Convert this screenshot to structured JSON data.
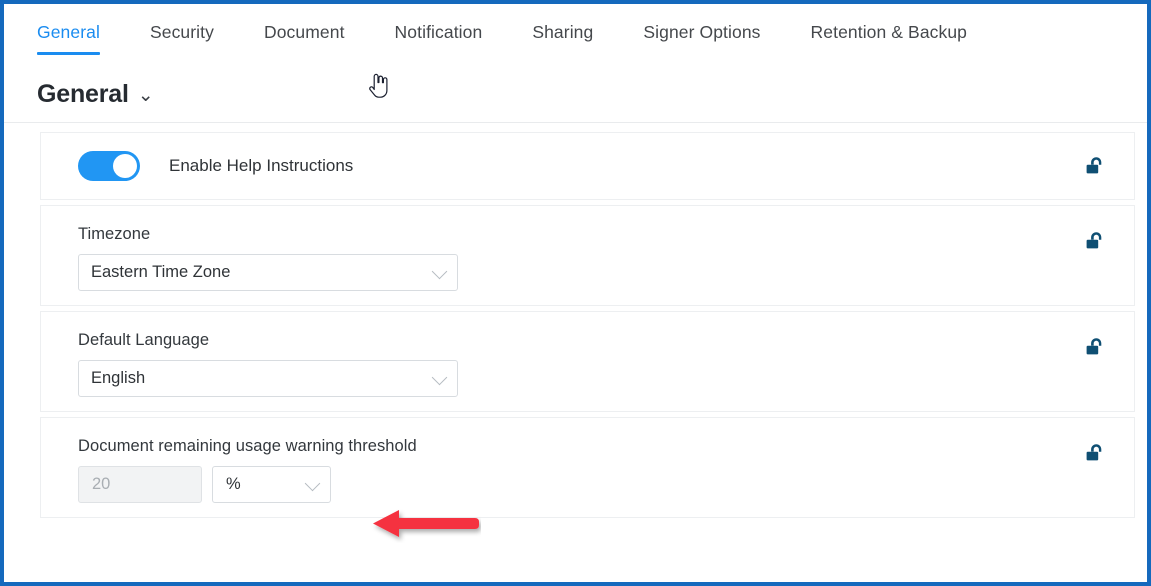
{
  "window": {
    "frame_color": "#1569bd"
  },
  "tabs": {
    "items": [
      {
        "label": "General",
        "active": true
      },
      {
        "label": "Security",
        "active": false
      },
      {
        "label": "Document",
        "active": false
      },
      {
        "label": "Notification",
        "active": false
      },
      {
        "label": "Sharing",
        "active": false
      },
      {
        "label": "Signer Options",
        "active": false
      },
      {
        "label": "Retention & Backup",
        "active": false
      }
    ],
    "active_color": "#1a8cf0",
    "inactive_color": "#45484c"
  },
  "section": {
    "title": "General",
    "chevron": "⌄"
  },
  "settings": [
    {
      "type": "toggle",
      "label": "Enable Help Instructions",
      "state": "on",
      "toggle_color": "#2196f3",
      "lock": "unlocked"
    },
    {
      "type": "select",
      "label": "Timezone",
      "value": "Eastern Time Zone",
      "lock": "unlocked"
    },
    {
      "type": "select",
      "label": "Default Language",
      "value": "English",
      "lock": "unlocked"
    },
    {
      "type": "number-unit",
      "label": "Document remaining usage warning threshold",
      "value": "",
      "placeholder": "20",
      "unit": "%",
      "lock": "unlocked"
    }
  ],
  "annotation": {
    "arrow_color": "#f5333f",
    "direction": "left"
  },
  "cursor": {
    "type": "pointer-hand"
  },
  "icons": {
    "lock_open": "unlock-icon",
    "chevron_down": "chevron-down-icon"
  }
}
